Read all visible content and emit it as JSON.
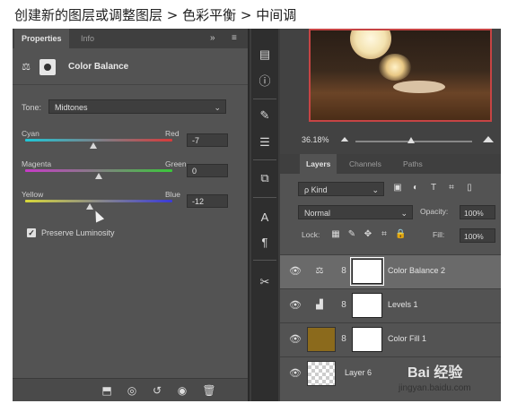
{
  "caption": "创建新的图层或调整图层 > 色彩平衡 > 中间调",
  "properties": {
    "tabs": [
      "Properties",
      "Info"
    ],
    "header_controls": [
      "»",
      "≡"
    ],
    "title": "Color Balance",
    "tone_label": "Tone:",
    "tone_value": "Midtones",
    "sliders": [
      {
        "left": "Cyan",
        "right": "Red",
        "value": "-7",
        "position": -7,
        "colors": [
          "#1ec8d8",
          "#d83a3a"
        ]
      },
      {
        "left": "Magenta",
        "right": "Green",
        "value": "0",
        "position": 0,
        "colors": [
          "#c83ac8",
          "#3ac83a"
        ]
      },
      {
        "left": "Yellow",
        "right": "Blue",
        "value": "-12",
        "position": -12,
        "colors": [
          "#d8d83a",
          "#3a3ad8"
        ]
      }
    ],
    "preserve_luminosity": {
      "label": "Preserve Luminosity",
      "checked": true
    },
    "footer_icons": [
      "clip-to-layer-icon",
      "view-previous-state-icon",
      "reset-icon",
      "visibility-icon",
      "delete-icon"
    ]
  },
  "toolstrip": {
    "icons": [
      "histogram-icon",
      "info-icon",
      "brush-preset-icon",
      "adjust-sliders-icon",
      "clone-source-icon",
      "character-icon",
      "paragraph-icon",
      "tools-icon"
    ]
  },
  "navigator": {
    "zoom": "36.18%"
  },
  "layers_panel": {
    "tabs": [
      "Layers",
      "Channels",
      "Paths"
    ],
    "kind_label": "ρ Kind",
    "blend_mode": "Normal",
    "opacity_label": "Opacity:",
    "opacity_value": "100%",
    "lock_label": "Lock:",
    "fill_label": "Fill:",
    "fill_value": "100%",
    "layers": [
      {
        "name": "Color Balance 2",
        "type": "adjustment",
        "selected": true
      },
      {
        "name": "Levels 1",
        "type": "adjustment",
        "selected": false
      },
      {
        "name": "Color Fill 1",
        "type": "fill",
        "selected": false
      },
      {
        "name": "Layer 6",
        "type": "pixel",
        "selected": false
      }
    ]
  },
  "watermark": {
    "text": "Bai 经验",
    "url": "jingyan.baidu.com"
  }
}
